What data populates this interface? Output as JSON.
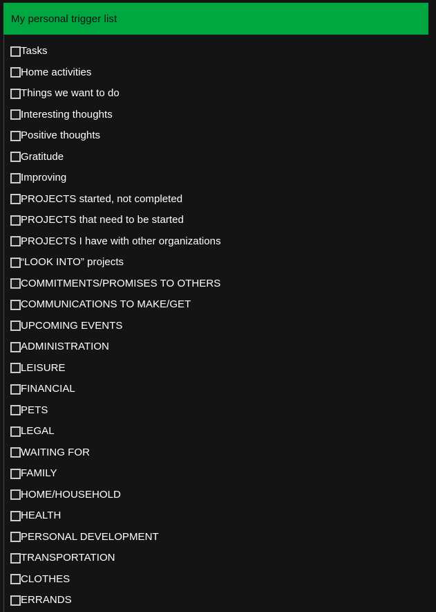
{
  "colors": {
    "header_background": "#00a63f",
    "header_text": "#111111",
    "page_background": "#141414",
    "item_text": "#ffffff",
    "checkbox_border": "#cfcfcf",
    "divider": "#4a4a4a"
  },
  "header": {
    "title": "My personal trigger list"
  },
  "list": {
    "items": [
      {
        "label": "Tasks",
        "checked": false
      },
      {
        "label": "Home activities",
        "checked": false
      },
      {
        "label": "Things we want to do",
        "checked": false
      },
      {
        "label": "Interesting thoughts",
        "checked": false
      },
      {
        "label": "Positive thoughts",
        "checked": false
      },
      {
        "label": "Gratitude",
        "checked": false
      },
      {
        "label": "Improving",
        "checked": false
      },
      {
        "label": "PROJECTS started, not completed",
        "checked": false
      },
      {
        "label": "PROJECTS that need to be started",
        "checked": false
      },
      {
        "label": "PROJECTS I have with other organizations",
        "checked": false
      },
      {
        "label": "“LOOK INTO” projects",
        "checked": false
      },
      {
        "label": "COMMITMENTS/PROMISES TO OTHERS",
        "checked": false
      },
      {
        "label": "COMMUNICATIONS TO MAKE/GET",
        "checked": false
      },
      {
        "label": "UPCOMING EVENTS",
        "checked": false
      },
      {
        "label": "ADMINISTRATION",
        "checked": false
      },
      {
        "label": "LEISURE",
        "checked": false
      },
      {
        "label": "FINANCIAL",
        "checked": false
      },
      {
        "label": "PETS",
        "checked": false
      },
      {
        "label": "LEGAL",
        "checked": false
      },
      {
        "label": "WAITING FOR",
        "checked": false
      },
      {
        "label": "FAMILY",
        "checked": false
      },
      {
        "label": "HOME/HOUSEHOLD",
        "checked": false
      },
      {
        "label": "HEALTH",
        "checked": false
      },
      {
        "label": "PERSONAL DEVELOPMENT",
        "checked": false
      },
      {
        "label": "TRANSPORTATION",
        "checked": false
      },
      {
        "label": "CLOTHES",
        "checked": false
      },
      {
        "label": "ERRANDS",
        "checked": false
      }
    ]
  }
}
